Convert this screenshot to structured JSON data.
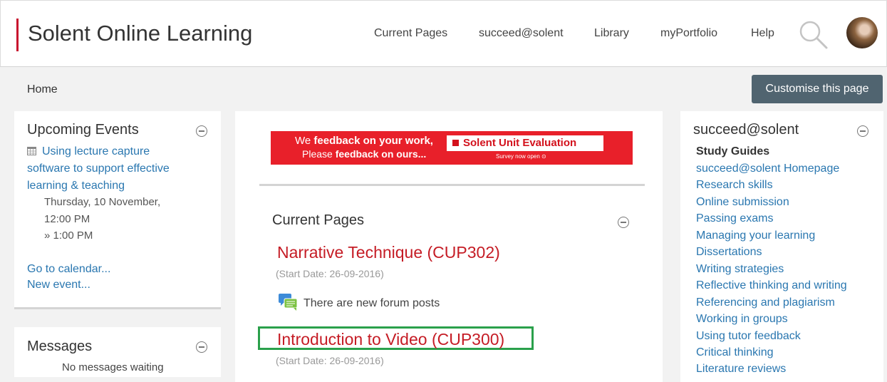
{
  "header": {
    "brand": "Solent Online Learning",
    "nav": [
      "Current Pages",
      "succeed@solent",
      "Library",
      "myPortfolio",
      "Help"
    ]
  },
  "breadcrumb": {
    "home": "Home"
  },
  "customise_button": "Customise this page",
  "upcoming_events": {
    "title": "Upcoming Events",
    "event_title_lines": [
      "Using lecture capture",
      "software to support effective",
      "learning & teaching"
    ],
    "date": "Thursday, 10 November,",
    "start_time": "12:00 PM",
    "end_time": "» 1:00 PM",
    "go_to_calendar": "Go to calendar...",
    "new_event": "New event..."
  },
  "messages": {
    "title": "Messages",
    "status": "No messages waiting"
  },
  "banner": {
    "line1_pre": "We ",
    "line1_bold": "feedback on your work,",
    "line2_pre": "Please ",
    "line2_bold": "feedback on ours...",
    "box_text": "Solent Unit Evaluation",
    "sub_text": "Survey now open ⊙"
  },
  "current_pages": {
    "title": "Current Pages",
    "courses": [
      {
        "title": "Narrative Technique (CUP302)",
        "start_date": "(Start Date: 26-09-2016)",
        "notice": "There are new forum posts"
      },
      {
        "title": "Introduction to Video (CUP300)",
        "start_date": "(Start Date: 26-09-2016)"
      }
    ]
  },
  "succeed": {
    "title": "succeed@solent",
    "subtitle": "Study Guides",
    "links": [
      "succeed@solent Homepage",
      "Research skills",
      "Online submission",
      "Passing exams",
      "Managing your learning",
      "Dissertations",
      "Writing strategies",
      "Reflective thinking and writing",
      "Referencing and plagiarism",
      "Working in groups",
      "Using tutor feedback",
      "Critical thinking",
      "Literature reviews"
    ]
  },
  "colors": {
    "brand_red": "#c8102e",
    "link_blue": "#2a77b0",
    "course_red": "#c51c25",
    "highlight_green": "#2aa04b",
    "button_slate": "#506470"
  }
}
